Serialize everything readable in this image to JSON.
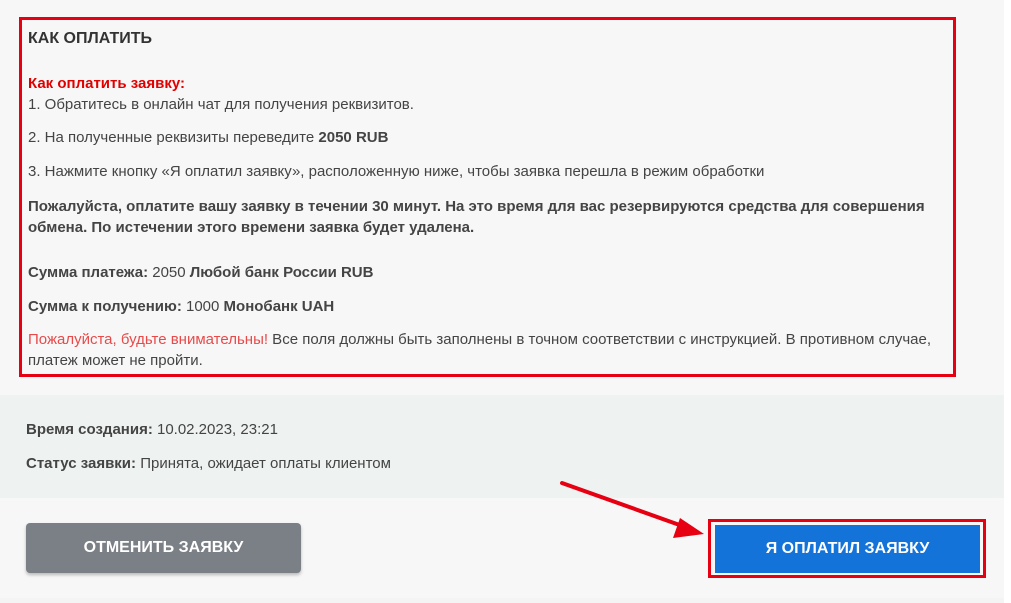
{
  "colors": {
    "highlight_border": "#e60012",
    "red_title": "#e00000",
    "warning_red": "#e84a4a",
    "cancel_button": "#7b7f86",
    "pay_button": "#1473d9",
    "meta_background": "#eef2f1"
  },
  "instructions": {
    "heading": "КАК ОПЛАТИТЬ",
    "red_title": "Как оплатить заявку:",
    "step1": "1. Обратитесь в онлайн чат для получения реквизитов.",
    "step2_prefix": "2. На полученные реквизиты переведите ",
    "step2_amount": "2050 RUB",
    "step3": "3. Нажмите кнопку «Я оплатил заявку», расположенную ниже, чтобы заявка перешла в режим обработки",
    "notice": "Пожалуйста, оплатите вашу заявку в течении 30 минут. На это время для вас резервируются средства для совершения обмена. По истечении этого времени заявка будет удалена.",
    "payment_label": "Сумма платежа:",
    "payment_amount": " 2050 ",
    "payment_method": "Любой банк России RUB",
    "receive_label": "Сумма к получению:",
    "receive_amount": " 1000 ",
    "receive_method": "Монобанк UAH",
    "warning_red": "Пожалуйста, будьте внимательны!",
    "warning_text": " Все поля должны быть заполнены в точном соответствии с инструкцией. В противном случае, платеж может не пройти."
  },
  "meta": {
    "created_label": "Время создания:",
    "created_value": " 10.02.2023, 23:21",
    "status_label": "Статус заявки:",
    "status_value": " Принята, ожидает оплаты клиентом"
  },
  "actions": {
    "cancel_label": "ОТМЕНИТЬ ЗАЯВКУ",
    "paid_label": "Я ОПЛАТИЛ ЗАЯВКУ"
  },
  "icons": {
    "annotation_arrow": "arrow-right-down-icon"
  }
}
